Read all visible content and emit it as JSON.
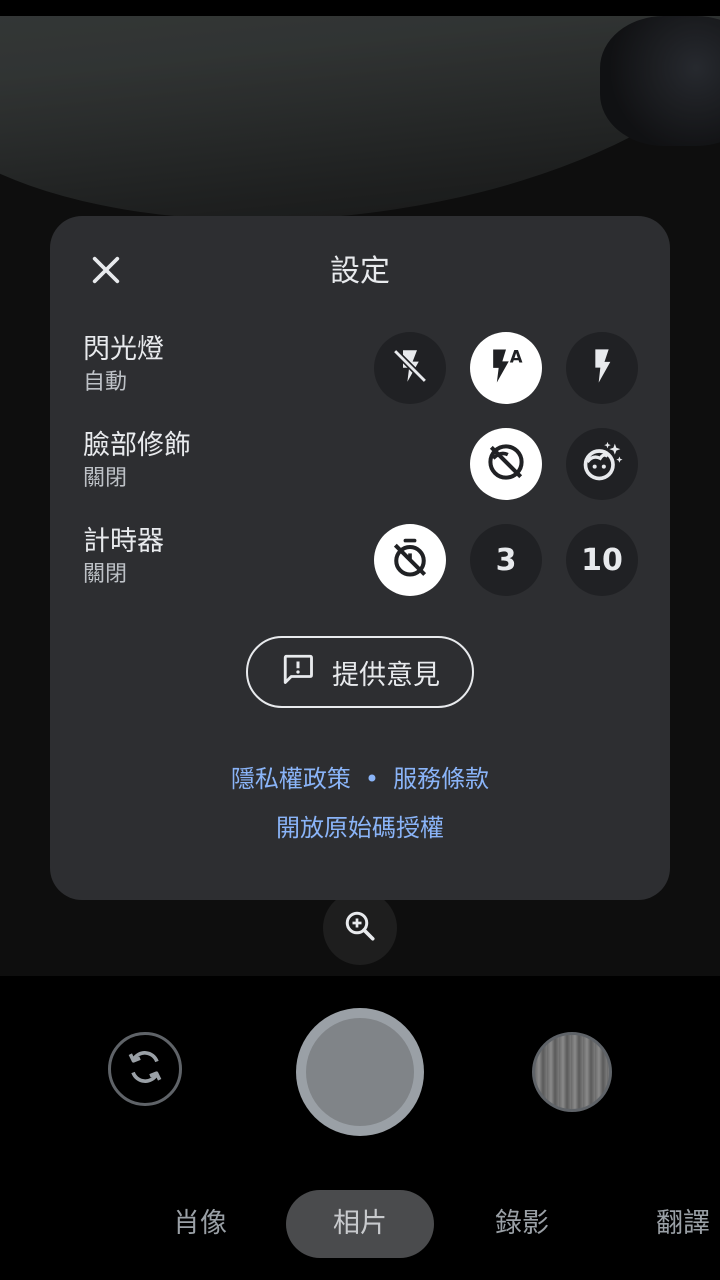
{
  "settings": {
    "title": "設定",
    "rows": [
      {
        "label": "閃光燈",
        "value": "自動"
      },
      {
        "label": "臉部修飾",
        "value": "關閉"
      },
      {
        "label": "計時器",
        "value": "關閉"
      }
    ],
    "flash_options": [
      "flash-off-icon",
      "flash-auto-icon",
      "flash-on-icon"
    ],
    "flash_selected": "flash-auto-icon",
    "retouch_options": [
      "face-retouch-off-icon",
      "face-retouch-on-icon"
    ],
    "retouch_selected": "face-retouch-off-icon",
    "timer_options": {
      "off": "timer-off-icon",
      "three": "3",
      "ten": "10"
    },
    "timer_selected": "timer-off-icon",
    "feedback_label": "提供意見",
    "links": {
      "privacy": "隱私權政策",
      "separator": "•",
      "terms": "服務條款",
      "licenses": "開放原始碼授權"
    }
  },
  "modes": {
    "portrait": "肖像",
    "photo": "相片",
    "video": "錄影",
    "translate": "翻譯",
    "selected": "相片"
  },
  "colors": {
    "panel": "#2d2e31",
    "link": "#8ab4f8",
    "selected_option": "#ffffff",
    "option_bg": "#202124"
  }
}
